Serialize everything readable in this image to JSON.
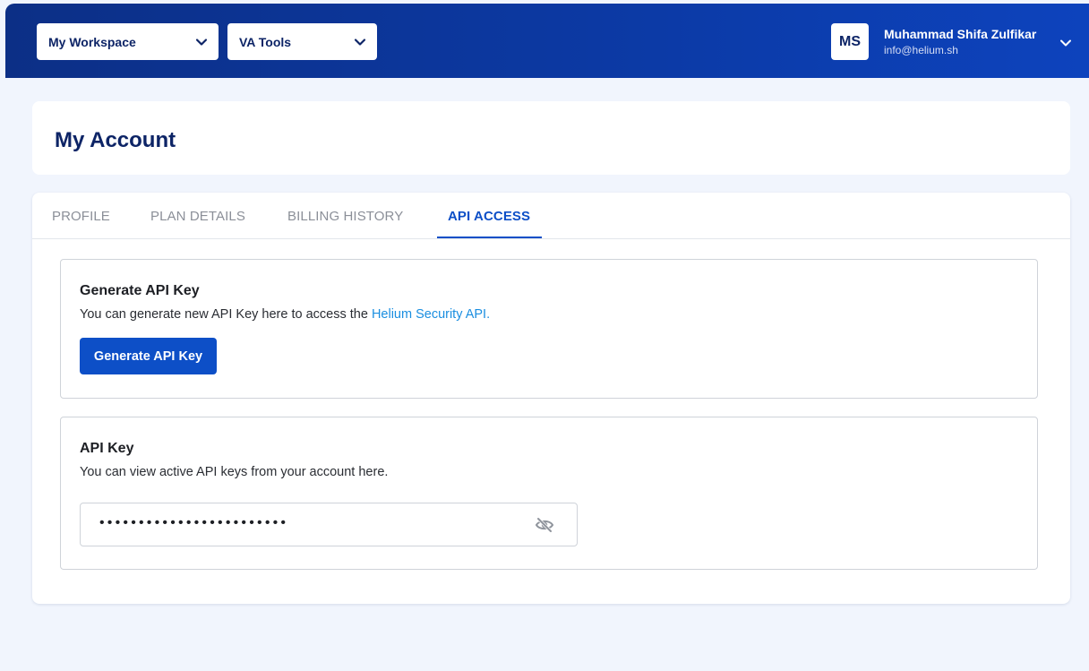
{
  "header": {
    "workspace_label": "My Workspace",
    "tools_label": "VA Tools",
    "avatar_initials": "MS",
    "user_name": "Muhammad Shifa Zulfikar",
    "user_email": "info@helium.sh"
  },
  "page": {
    "title": "My Account"
  },
  "tabs": [
    {
      "label": "PROFILE",
      "active": false
    },
    {
      "label": "PLAN DETAILS",
      "active": false
    },
    {
      "label": "BILLING HISTORY",
      "active": false
    },
    {
      "label": "API ACCESS",
      "active": true
    }
  ],
  "generate_section": {
    "title": "Generate API Key",
    "desc_prefix": "You can generate new API Key here to access the ",
    "desc_link": "Helium Security API.",
    "button_label": "Generate API Key"
  },
  "key_section": {
    "title": "API Key",
    "desc": "You can view active API keys from your account here.",
    "masked_value": "••••••••••••••••••••••••"
  },
  "colors": {
    "primary": "#0d4fc7",
    "link": "#1a8ee0",
    "header_dark": "#0c2f86",
    "heading": "#0d2466"
  },
  "icons": {
    "dropdown": "chevron-down-icon",
    "visibility": "eye-off-icon"
  }
}
